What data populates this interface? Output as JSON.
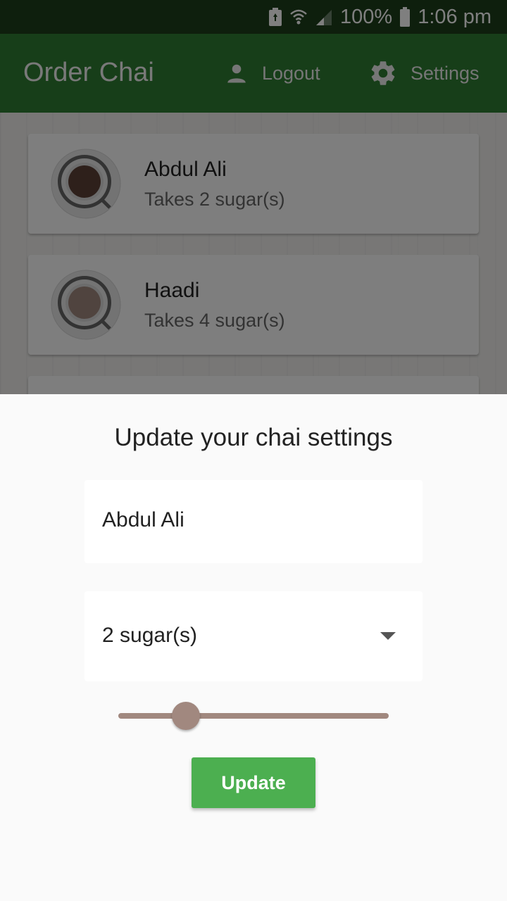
{
  "status_bar": {
    "battery_percent": "100%",
    "time": "1:06 pm",
    "icons": [
      "battery-saver-icon",
      "wifi-icon",
      "signal-icon",
      "battery-icon"
    ]
  },
  "app_bar": {
    "title": "Order Chai",
    "logout_label": "Logout",
    "settings_label": "Settings",
    "icons": [
      "person-icon",
      "gear-icon"
    ],
    "color": "#2e7d32"
  },
  "list": {
    "items": [
      {
        "name": "Abdul Ali",
        "subtitle": "Takes 2 sugar(s)",
        "cup_color": "#5d4037"
      },
      {
        "name": "Haadi",
        "subtitle": "Takes 4 sugar(s)",
        "cup_color": "#a1887f"
      }
    ]
  },
  "sheet": {
    "title": "Update your chai settings",
    "name_value": "Abdul Ali",
    "sugar_value": "2 sugar(s)",
    "slider_fraction": 0.25,
    "slider_color": "#a1887f",
    "update_label": "Update",
    "button_color": "#4caf50"
  }
}
